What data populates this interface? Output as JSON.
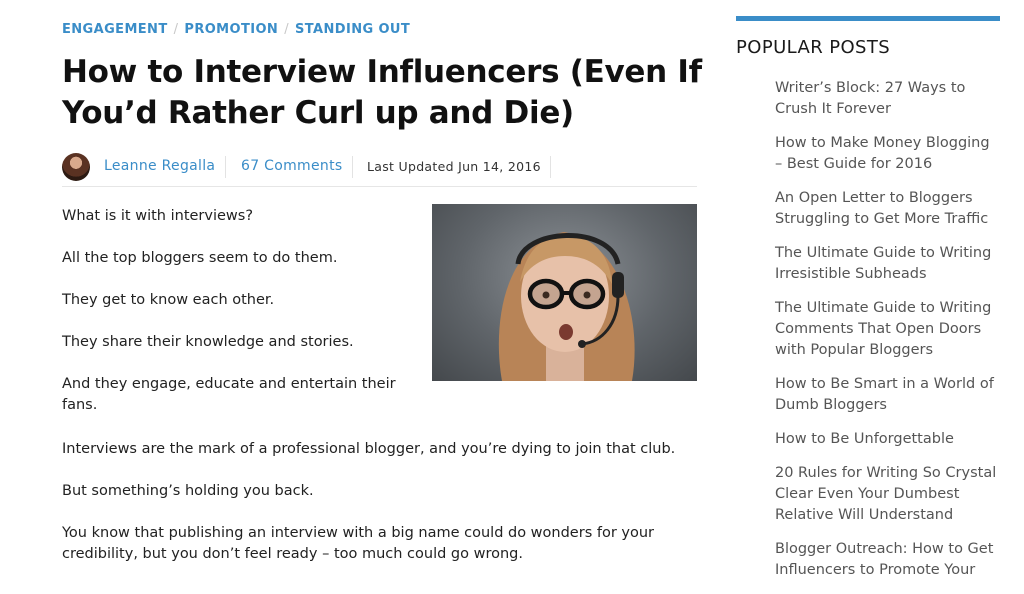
{
  "breadcrumbs": [
    "ENGAGEMENT",
    "PROMOTION",
    "STANDING OUT"
  ],
  "breadcrumb_separator": "/",
  "article": {
    "title": "How to Interview Influencers (Even If You’d Rather Curl up and Die)",
    "author": "Leanne Regalla",
    "comments": "67 Comments",
    "updated": "Last Updated Jun 14, 2016",
    "paragraphs": [
      "What is it with interviews?",
      "All the top bloggers seem to do them.",
      "They get to know each other.",
      "They share their knowledge and stories.",
      "And they engage, educate and entertain their fans.",
      "Interviews are the mark of a professional blogger, and you’re dying to join that club.",
      "But something’s holding you back.",
      "You know that publishing an interview with a big name could do wonders for your credibility, but you don’t feel ready – too much could go wrong."
    ]
  },
  "sidebar": {
    "title": "POPULAR POSTS",
    "accent_color": "#3a8dc8",
    "posts": [
      "Writer’s Block: 27 Ways to Crush It Forever",
      "How to Make Money Blogging – Best Guide for 2016",
      "An Open Letter to Bloggers Struggling to Get More Traffic",
      "The Ultimate Guide to Writing Irresistible Subheads",
      "The Ultimate Guide to Writing Comments That Open Doors with Popular Bloggers",
      "How to Be Smart in a World of Dumb Bloggers",
      "How to Be Unforgettable",
      "20 Rules for Writing So Crystal Clear Even Your Dumbest Relative Will Understand",
      "Blogger Outreach: How to Get Influencers to Promote Your"
    ]
  },
  "colors": {
    "link": "#3a8dc8",
    "text": "#222222",
    "sidebar_text": "#555555"
  }
}
